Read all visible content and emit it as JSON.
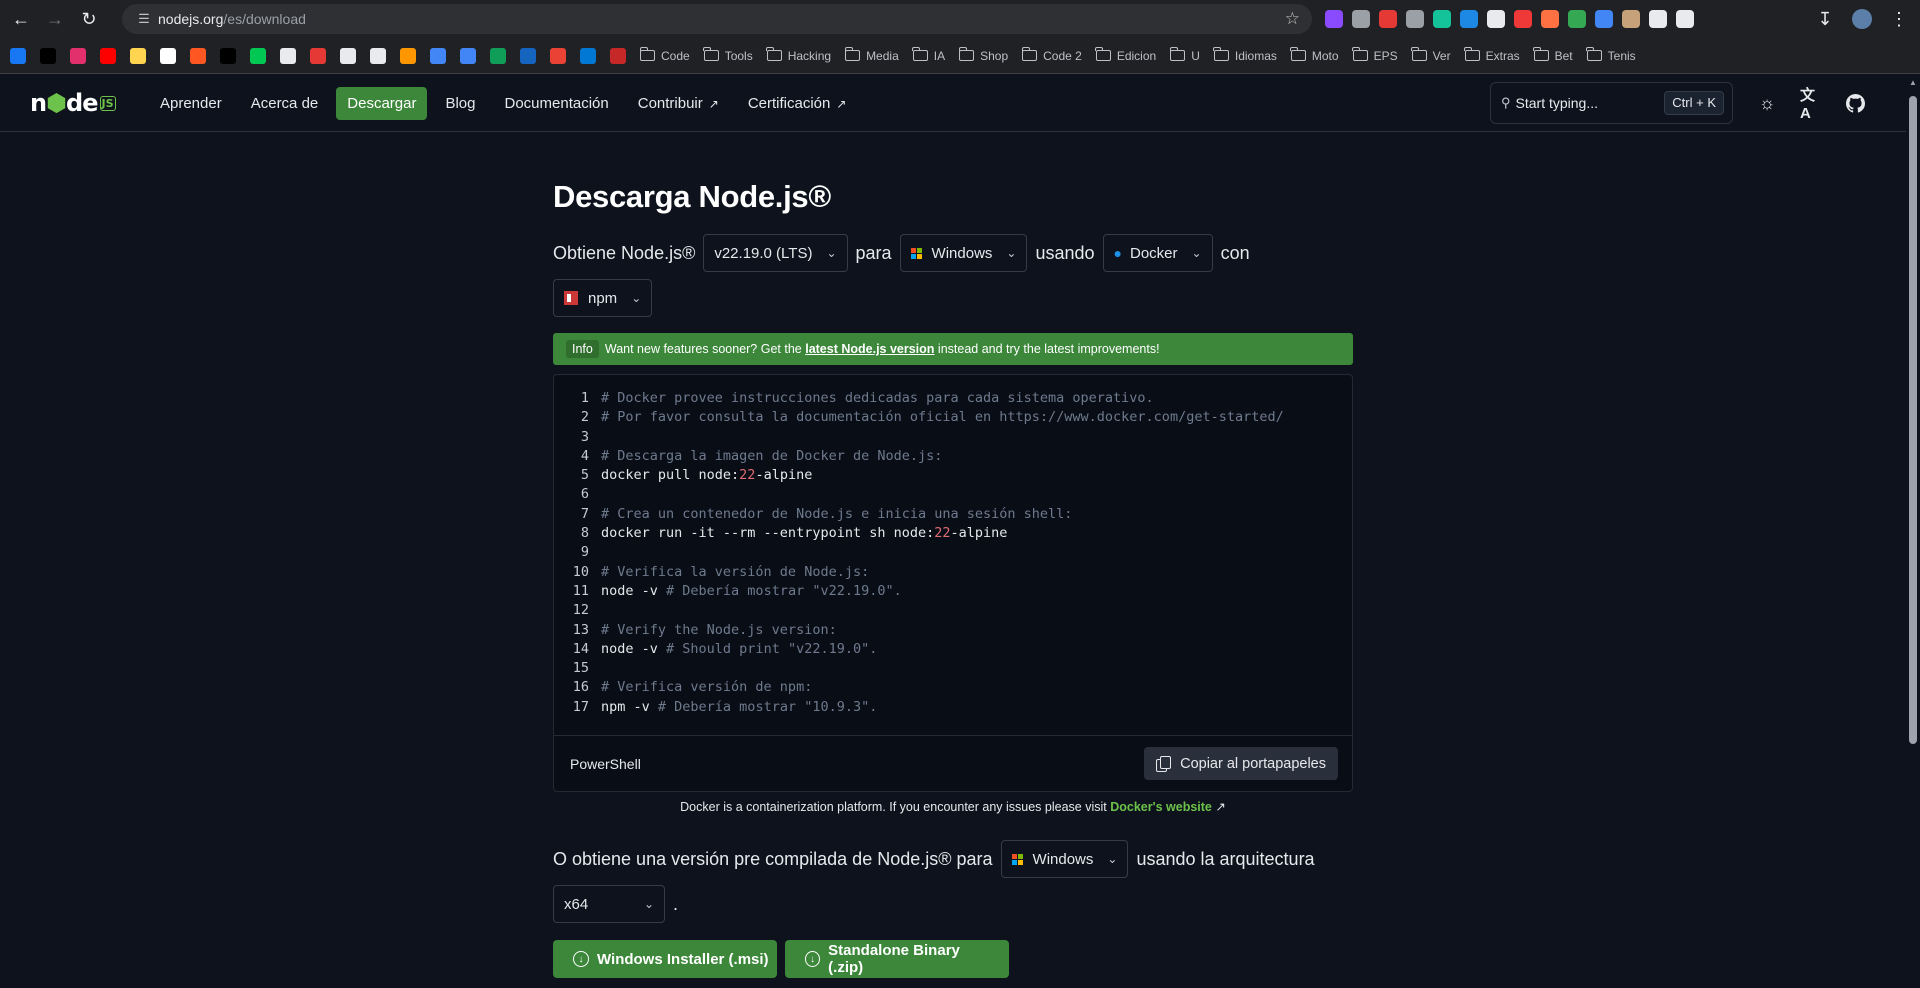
{
  "browser": {
    "url_host": "nodejs.org",
    "url_path": "/es/download",
    "extension_colors": [
      "#8a4bff",
      "#9aa0a6",
      "#e53935",
      "#9aa0a6",
      "#15c39a",
      "#1e88e5",
      "#e8eaed",
      "#ef3939",
      "#ff7043",
      "#34a853",
      "#4285f4",
      "#c7a17a",
      "#e8eaed",
      "#e8eaed"
    ],
    "bookmark_icon_colors": [
      "#1877f2",
      "#000000",
      "#e1306c",
      "#ff0000",
      "#ffd54f",
      "#ffffff",
      "#ff5722",
      "#000000",
      "#00c853",
      "#e8eaed",
      "#e53935",
      "#e8eaed",
      "#e8eaed",
      "#ff9800",
      "#4285f4",
      "#4285f4",
      "#0f9d58",
      "#1565c0",
      "#ea4335",
      "#0078d4",
      "#c62828"
    ],
    "bookmark_folders": [
      "Code",
      "Tools",
      "Hacking",
      "Media",
      "IA",
      "Shop",
      "Code 2",
      "Edicion",
      "U",
      "Idiomas",
      "Moto",
      "EPS",
      "Ver",
      "Extras",
      "Bet",
      "Tenis"
    ]
  },
  "header": {
    "nav": [
      {
        "label": "Aprender",
        "active": false,
        "external": false
      },
      {
        "label": "Acerca de",
        "active": false,
        "external": false
      },
      {
        "label": "Descargar",
        "active": true,
        "external": false
      },
      {
        "label": "Blog",
        "active": false,
        "external": false
      },
      {
        "label": "Documentación",
        "active": false,
        "external": false
      },
      {
        "label": "Contribuir",
        "active": false,
        "external": true
      },
      {
        "label": "Certificación",
        "active": false,
        "external": true
      }
    ],
    "search_placeholder": "Start typing...",
    "search_shortcut": "Ctrl + K"
  },
  "main": {
    "title": "Descarga Node.js®",
    "sentence1": {
      "prefix": "Obtiene Node.js®",
      "version": "v22.19.0 (LTS)",
      "word_para": "para",
      "os": "Windows",
      "word_using": "usando",
      "method": "Docker",
      "word_with": "con",
      "package_manager": "npm"
    },
    "info": {
      "badge": "Info",
      "text_before": "Want new features sooner? Get the",
      "link": "latest Node.js version",
      "text_after": "instead and try the latest improvements!"
    },
    "code_lines": [
      {
        "n": "1",
        "parts": [
          {
            "t": "# Docker provee instrucciones dedicadas para cada sistema operativo.",
            "k": "c"
          }
        ]
      },
      {
        "n": "2",
        "parts": [
          {
            "t": "# Por favor consulta la documentación oficial en https://www.docker.com/get-started/",
            "k": "c"
          }
        ]
      },
      {
        "n": "3",
        "parts": []
      },
      {
        "n": "4",
        "parts": [
          {
            "t": "# Descarga la imagen de Docker de Node.js:",
            "k": "c"
          }
        ]
      },
      {
        "n": "5",
        "parts": [
          {
            "t": "docker pull node:",
            "k": ""
          },
          {
            "t": "22",
            "k": "n"
          },
          {
            "t": "-alpine",
            "k": ""
          }
        ]
      },
      {
        "n": "6",
        "parts": []
      },
      {
        "n": "7",
        "parts": [
          {
            "t": "# Crea un contenedor de Node.js e inicia una sesión shell:",
            "k": "c"
          }
        ]
      },
      {
        "n": "8",
        "parts": [
          {
            "t": "docker run -it --rm --entrypoint sh node:",
            "k": ""
          },
          {
            "t": "22",
            "k": "n"
          },
          {
            "t": "-alpine",
            "k": ""
          }
        ]
      },
      {
        "n": "9",
        "parts": []
      },
      {
        "n": "10",
        "parts": [
          {
            "t": "# Verifica la versión de Node.js:",
            "k": "c"
          }
        ]
      },
      {
        "n": "11",
        "parts": [
          {
            "t": "node -v ",
            "k": ""
          },
          {
            "t": "# Debería mostrar \"v22.19.0\".",
            "k": "c"
          }
        ]
      },
      {
        "n": "12",
        "parts": []
      },
      {
        "n": "13",
        "parts": [
          {
            "t": "# Verify the Node.js version:",
            "k": "c"
          }
        ]
      },
      {
        "n": "14",
        "parts": [
          {
            "t": "node -v ",
            "k": ""
          },
          {
            "t": "# Should print \"v22.19.0\".",
            "k": "c"
          }
        ]
      },
      {
        "n": "15",
        "parts": []
      },
      {
        "n": "16",
        "parts": [
          {
            "t": "# Verifica versión de npm:",
            "k": "c"
          }
        ]
      },
      {
        "n": "17",
        "parts": [
          {
            "t": "npm -v ",
            "k": ""
          },
          {
            "t": "# Debería mostrar \"10.9.3\".",
            "k": "c"
          }
        ]
      }
    ],
    "code_language": "PowerShell",
    "copy_label": "Copiar al portapapeles",
    "docker_note": "Docker is a containerization platform. If you encounter any issues please visit",
    "docker_link": "Docker's website",
    "sentence2": {
      "prefix": "O obtiene una versión pre compilada de Node.js® para",
      "os": "Windows",
      "suffix": "usando la arquitectura",
      "arch": "x64",
      "period": "."
    },
    "downloads": [
      "Windows Installer (.msi)",
      "Standalone Binary (.zip)"
    ]
  }
}
